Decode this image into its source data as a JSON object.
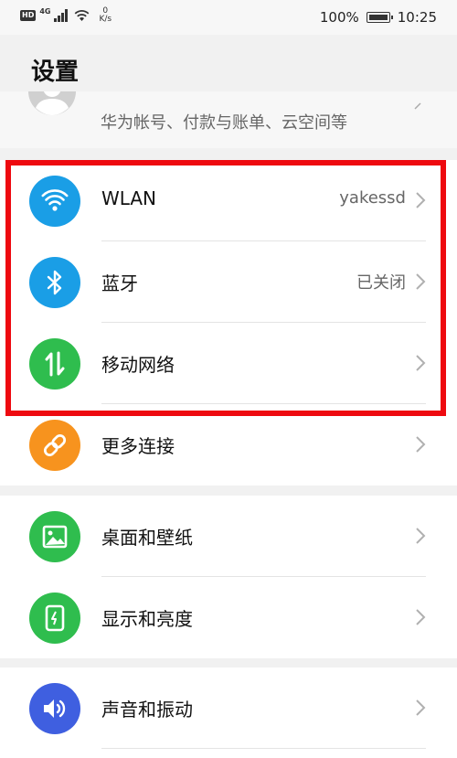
{
  "status_bar": {
    "hd": "HD",
    "network": "4G",
    "speed_value": "0",
    "speed_unit": "K/s",
    "battery_percent": "100%",
    "time": "10:25"
  },
  "page": {
    "title": "设置"
  },
  "account": {
    "description": "华为帐号、付款与账单、云空间等"
  },
  "groups": [
    {
      "rows": [
        {
          "label": "WLAN",
          "value": "yakessd",
          "icon": "wifi-icon",
          "color": "#1a9ee6"
        },
        {
          "label": "蓝牙",
          "value": "已关闭",
          "icon": "bluetooth-icon",
          "color": "#1a9ee6"
        },
        {
          "label": "移动网络",
          "value": "",
          "icon": "mobile-data-icon",
          "color": "#2fbd4e"
        },
        {
          "label": "更多连接",
          "value": "",
          "icon": "link-icon",
          "color": "#f7931e"
        }
      ]
    },
    {
      "rows": [
        {
          "label": "桌面和壁纸",
          "value": "",
          "icon": "image-icon",
          "color": "#2fbd4e"
        },
        {
          "label": "显示和亮度",
          "value": "",
          "icon": "display-icon",
          "color": "#2fbd4e"
        }
      ]
    },
    {
      "rows": [
        {
          "label": "声音和振动",
          "value": "",
          "icon": "sound-icon",
          "color": "#3f5fe0"
        }
      ]
    }
  ],
  "highlight_color": "#ee0a10"
}
